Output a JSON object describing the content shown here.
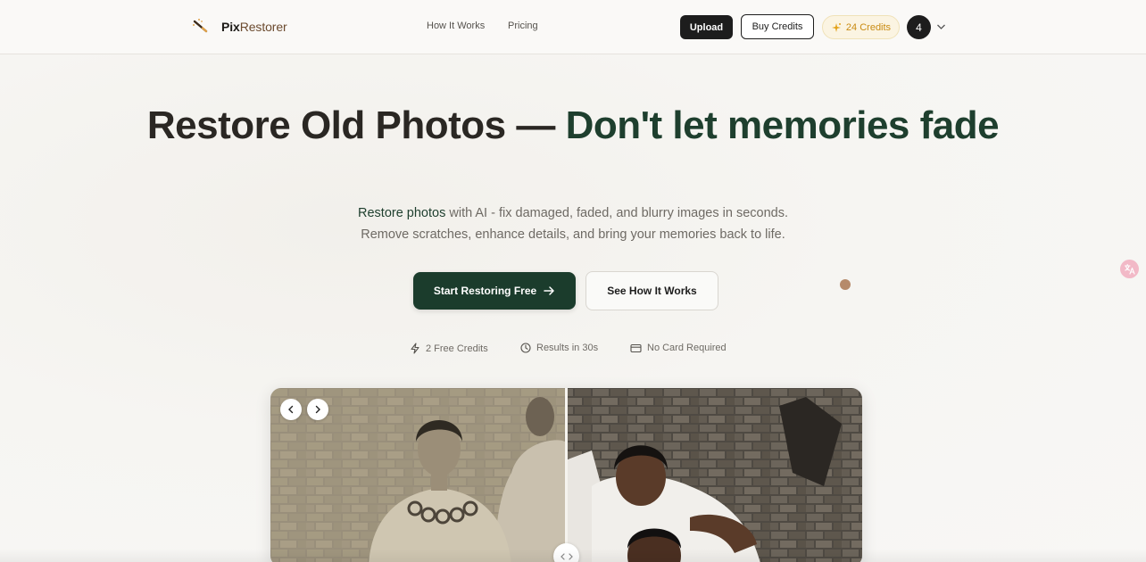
{
  "header": {
    "logo_pix": "Pix",
    "logo_rest": "Restorer",
    "nav": [
      {
        "label": "How It Works"
      },
      {
        "label": "Pricing"
      }
    ],
    "upload_label": "Upload",
    "buy_credits_label": "Buy Credits",
    "credits_label": "24 Credits",
    "avatar_initial": "4"
  },
  "hero": {
    "title_part1": "Restore Old Photos — ",
    "title_part2": "Don't let memories fade",
    "sub_strong": "Restore photos",
    "sub_line1_rest": " with AI - fix damaged, faded, and blurry images in seconds.",
    "sub_line2": "Remove scratches, enhance details, and bring your memories back to life.",
    "cta_primary": "Start Restoring Free",
    "cta_secondary": "See How It Works"
  },
  "features": [
    {
      "icon": "lightning-icon",
      "label": "2 Free Credits"
    },
    {
      "icon": "clock-icon",
      "label": "Results in 30s"
    },
    {
      "icon": "card-icon",
      "label": "No Card Required"
    }
  ],
  "colors": {
    "accent_green": "#1b3c2c",
    "credits_gold": "#c98b12",
    "dark": "#1d1d1d"
  }
}
